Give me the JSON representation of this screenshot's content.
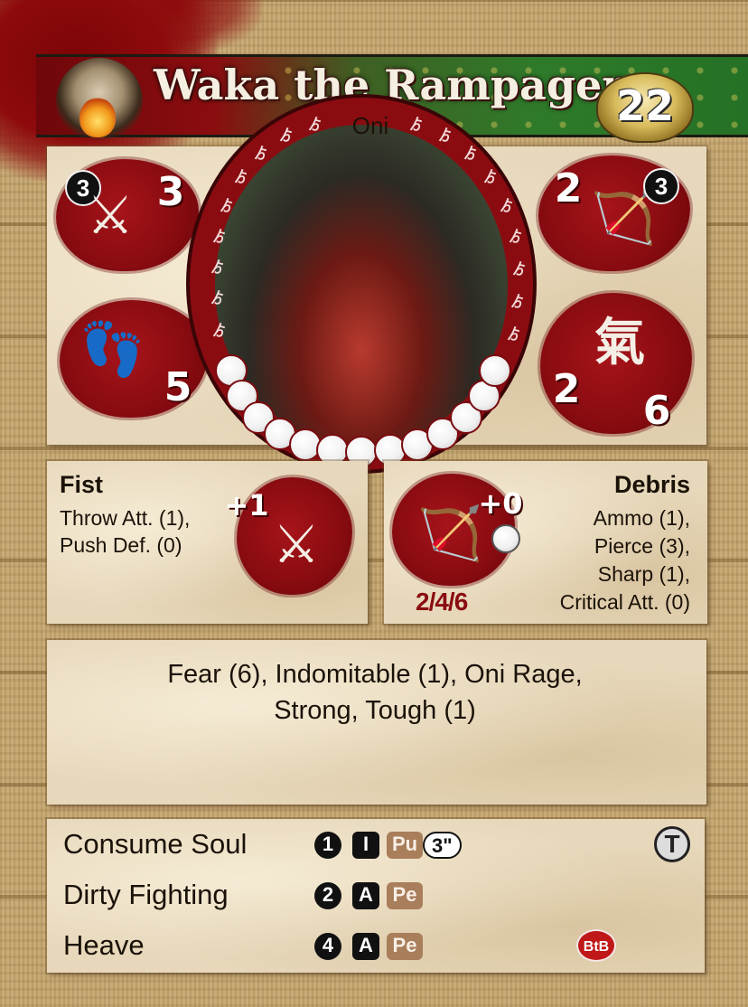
{
  "card": {
    "name": "Waka the Rampager",
    "faction": "Oni",
    "cost": "22"
  },
  "stats": {
    "melee": {
      "pool": "3",
      "value": "3",
      "icon": "crossed-swords-icon"
    },
    "ranged": {
      "value": "2",
      "pool": "3",
      "icon": "bow-arrow-icon"
    },
    "move": {
      "value": "5",
      "icon": "foot-icon"
    },
    "ki": {
      "glyph": "氣",
      "current": "2",
      "max": "6"
    },
    "wounds_pearls": 13
  },
  "melee_weapon": {
    "name": "Fist",
    "traits": [
      "Throw Att. (1),",
      "Push Def. (0)"
    ],
    "modifier": "+1"
  },
  "ranged_weapon": {
    "name": "Debris",
    "traits": [
      "Ammo (1),",
      "Pierce (3),",
      "Sharp (1),",
      "Critical Att. (0)"
    ],
    "modifier": "+0",
    "range": "2/4/6"
  },
  "abilities": {
    "line1": "Fear (6), Indomitable (1), Oni Rage,",
    "line2": "Strong, Tough (1)"
  },
  "actions": [
    {
      "name": "Consume Soul",
      "cost": "1",
      "type": "I",
      "tag": "Pu",
      "range": "3\"",
      "marker": "T"
    },
    {
      "name": "Dirty Fighting",
      "cost": "2",
      "type": "A",
      "tag": "Pe"
    },
    {
      "name": "Heave",
      "cost": "4",
      "type": "A",
      "tag": "Pe",
      "marker": "BtB"
    }
  ],
  "colors": {
    "blood": "#8a0c11",
    "banner_green": "#2f7a2a",
    "parchment": "#e7d8bb"
  }
}
